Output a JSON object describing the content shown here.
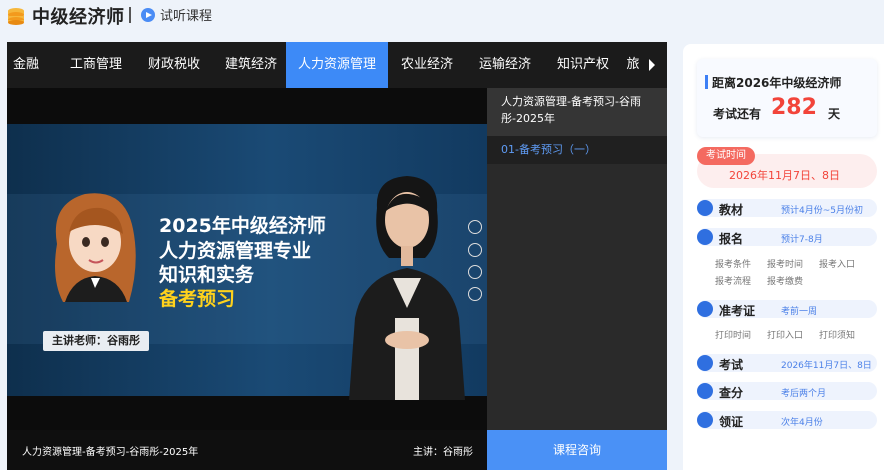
{
  "header": {
    "title": "中级经济师",
    "trial_label": "试听课程"
  },
  "nav": {
    "tabs": [
      {
        "label": "金融",
        "active": false
      },
      {
        "label": "工商管理",
        "active": false
      },
      {
        "label": "财政税收",
        "active": false
      },
      {
        "label": "建筑经济",
        "active": false
      },
      {
        "label": "人力资源管理",
        "active": true
      },
      {
        "label": "农业经济",
        "active": false
      },
      {
        "label": "运输经济",
        "active": false
      },
      {
        "label": "知识产权",
        "active": false
      },
      {
        "label": "旅",
        "active": false
      }
    ]
  },
  "video": {
    "lines": [
      "2025年中级经济师",
      "人力资源管理专业",
      "知识和实务",
      "备考预习"
    ],
    "teacher_tag": "主讲老师：谷雨彤",
    "caption_title": "人力资源管理-备考预习-谷雨彤-2025年",
    "caption_teacher": "主讲：谷雨彤"
  },
  "playlist": {
    "title": "人力资源管理-备考预习-谷雨彤-2025年",
    "items": [
      "01-备考预习（一）"
    ],
    "consult_button": "课程咨询"
  },
  "countdown": {
    "title": "距离2026年中级经济师",
    "prefix": "考试还有",
    "days": "282",
    "unit": "天"
  },
  "exam_time": {
    "tag": "考试时间",
    "value": "2026年11月7日、8日"
  },
  "schedule": {
    "material": {
      "label": "教材",
      "note": "预计4月份~5月份初"
    },
    "signup": {
      "label": "报名",
      "note": "预计7-8月",
      "links": [
        "报考条件",
        "报考时间",
        "报考入口",
        "报考流程",
        "报考缴费"
      ]
    },
    "admission": {
      "label": "准考证",
      "note": "考前一周",
      "links": [
        "打印时间",
        "打印入口",
        "打印须知"
      ]
    },
    "exam": {
      "label": "考试",
      "note": "2026年11月7日、8日"
    },
    "score": {
      "label": "查分",
      "note": "考后两个月"
    },
    "certificate": {
      "label": "领证",
      "note": "次年4月份"
    }
  },
  "colors": {
    "accent": "#3d8af7",
    "countdown_red": "#f2443a"
  }
}
